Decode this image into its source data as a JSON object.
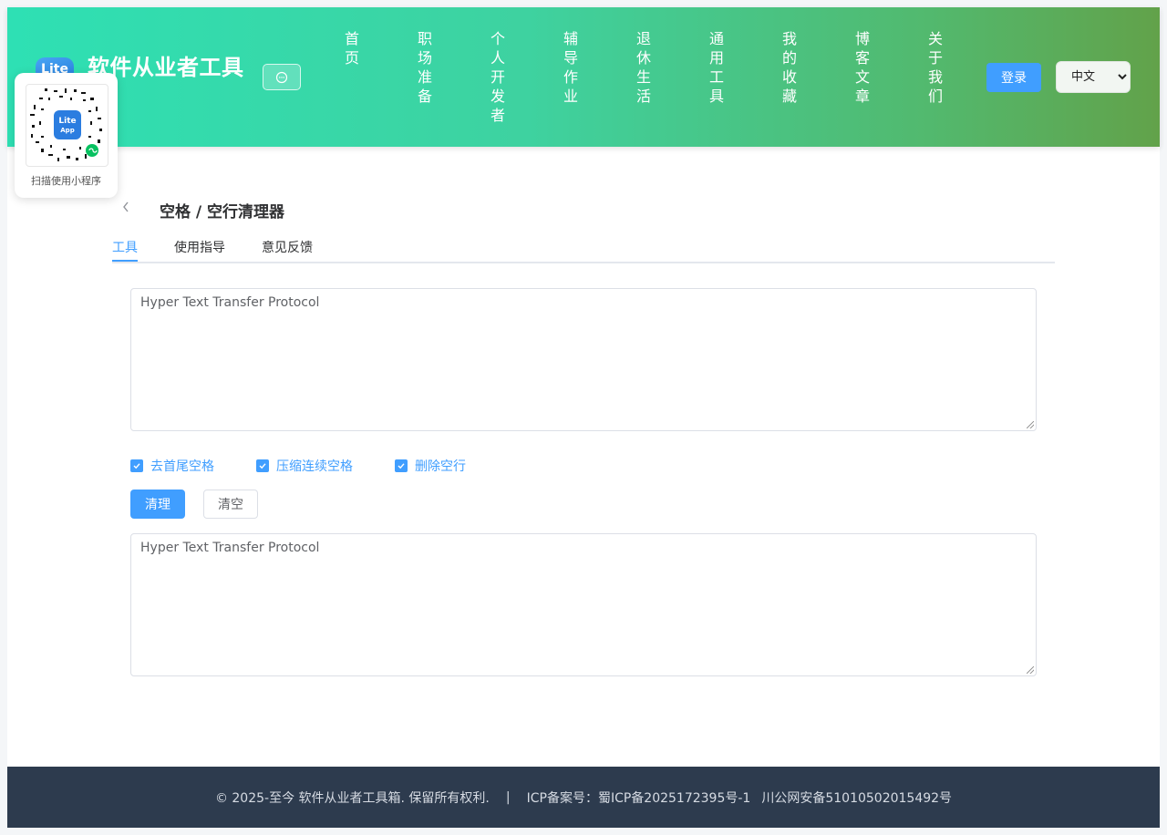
{
  "header": {
    "logo_text": "Lite",
    "site_title": "软件从业者工具",
    "nav": [
      {
        "label": "首页"
      },
      {
        "label": "职场准备"
      },
      {
        "label": "个人开发者"
      },
      {
        "label": "辅导作业"
      },
      {
        "label": "退休生活"
      },
      {
        "label": "通用工具"
      },
      {
        "label": "我的收藏"
      },
      {
        "label": "博客文章"
      },
      {
        "label": "关于我们"
      }
    ],
    "login_label": "登录",
    "language": {
      "selected": "中文"
    }
  },
  "qr": {
    "badge_line1": "Lite",
    "badge_line2": "App",
    "caption": "扫描使用小程序"
  },
  "page": {
    "title": "空格 / 空行清理器",
    "tabs": [
      {
        "label": "工具",
        "active": true
      },
      {
        "label": "使用指导",
        "active": false
      },
      {
        "label": "意见反馈",
        "active": false
      }
    ]
  },
  "tool": {
    "input_value": "Hyper Text Transfer Protocol",
    "options": [
      {
        "label": "去首尾空格",
        "checked": true
      },
      {
        "label": "压缩连续空格",
        "checked": true
      },
      {
        "label": "删除空行",
        "checked": true
      }
    ],
    "clean_label": "清理",
    "clear_label": "清空",
    "output_value": "Hyper Text Transfer Protocol"
  },
  "footer": {
    "copyright": "© 2025-至今 软件从业者工具箱. 保留所有权利.",
    "separator": "|",
    "icp": "ICP备案号：蜀ICP备2025172395号-1",
    "police": "川公网安备51010502015492号"
  },
  "colors": {
    "primary": "#409eff",
    "header_gradient_start": "#2ee0b4",
    "header_gradient_end": "#62a24a",
    "footer_bg": "#2d3b4e"
  }
}
